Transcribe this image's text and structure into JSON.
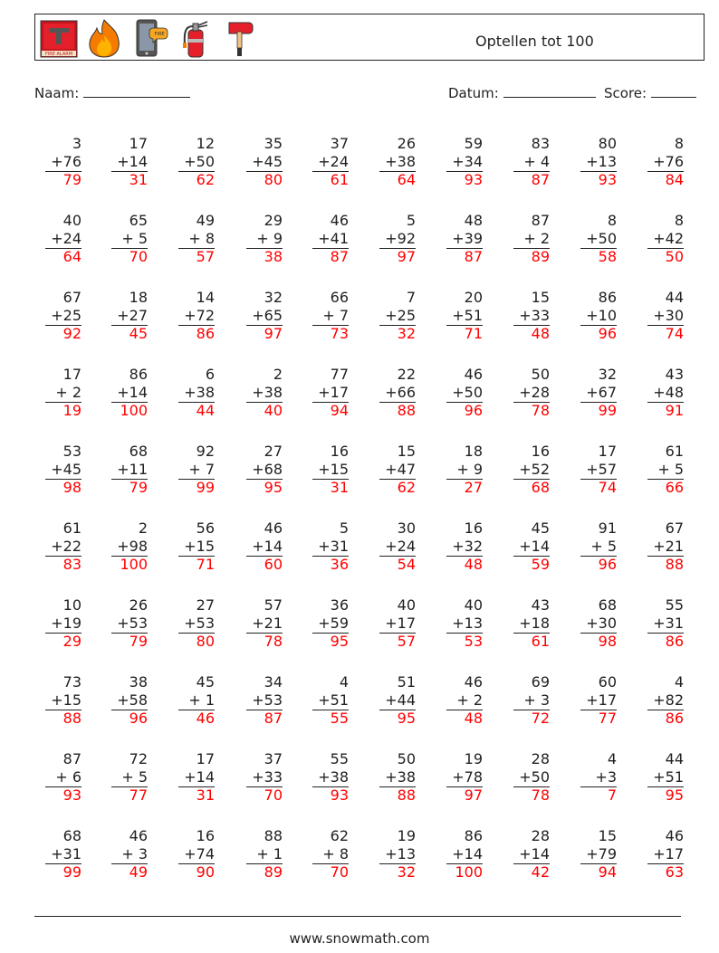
{
  "header": {
    "title": "Optellen tot 100",
    "icons": [
      "fire-alarm-icon",
      "fire-icon",
      "phone-fire-icon",
      "fire-extinguisher-icon",
      "fire-axe-icon"
    ],
    "fire_alarm_label": "FIRE ALARM",
    "phone_bubble_label": "FIRE"
  },
  "meta": {
    "name_label": "Naam:",
    "date_label": "Datum:",
    "score_label": "Score:"
  },
  "colors": {
    "answer": "#ff0000",
    "text": "#222222"
  },
  "problems": [
    [
      {
        "a": "3",
        "b": "+76",
        "ans": "79"
      },
      {
        "a": "17",
        "b": "+14",
        "ans": "31"
      },
      {
        "a": "12",
        "b": "+50",
        "ans": "62"
      },
      {
        "a": "35",
        "b": "+45",
        "ans": "80"
      },
      {
        "a": "37",
        "b": "+24",
        "ans": "61"
      },
      {
        "a": "26",
        "b": "+38",
        "ans": "64"
      },
      {
        "a": "59",
        "b": "+34",
        "ans": "93"
      },
      {
        "a": "83",
        "b": "+ 4",
        "ans": "87"
      },
      {
        "a": "80",
        "b": "+13",
        "ans": "93"
      },
      {
        "a": "8",
        "b": "+76",
        "ans": "84"
      }
    ],
    [
      {
        "a": "40",
        "b": "+24",
        "ans": "64"
      },
      {
        "a": "65",
        "b": "+ 5",
        "ans": "70"
      },
      {
        "a": "49",
        "b": "+ 8",
        "ans": "57"
      },
      {
        "a": "29",
        "b": "+ 9",
        "ans": "38"
      },
      {
        "a": "46",
        "b": "+41",
        "ans": "87"
      },
      {
        "a": "5",
        "b": "+92",
        "ans": "97"
      },
      {
        "a": "48",
        "b": "+39",
        "ans": "87"
      },
      {
        "a": "87",
        "b": "+ 2",
        "ans": "89"
      },
      {
        "a": "8",
        "b": "+50",
        "ans": "58"
      },
      {
        "a": "8",
        "b": "+42",
        "ans": "50"
      }
    ],
    [
      {
        "a": "67",
        "b": "+25",
        "ans": "92"
      },
      {
        "a": "18",
        "b": "+27",
        "ans": "45"
      },
      {
        "a": "14",
        "b": "+72",
        "ans": "86"
      },
      {
        "a": "32",
        "b": "+65",
        "ans": "97"
      },
      {
        "a": "66",
        "b": "+ 7",
        "ans": "73"
      },
      {
        "a": "7",
        "b": "+25",
        "ans": "32"
      },
      {
        "a": "20",
        "b": "+51",
        "ans": "71"
      },
      {
        "a": "15",
        "b": "+33",
        "ans": "48"
      },
      {
        "a": "86",
        "b": "+10",
        "ans": "96"
      },
      {
        "a": "44",
        "b": "+30",
        "ans": "74"
      }
    ],
    [
      {
        "a": "17",
        "b": "+ 2",
        "ans": "19"
      },
      {
        "a": "86",
        "b": "+14",
        "ans": "100"
      },
      {
        "a": "6",
        "b": "+38",
        "ans": "44"
      },
      {
        "a": "2",
        "b": "+38",
        "ans": "40"
      },
      {
        "a": "77",
        "b": "+17",
        "ans": "94"
      },
      {
        "a": "22",
        "b": "+66",
        "ans": "88"
      },
      {
        "a": "46",
        "b": "+50",
        "ans": "96"
      },
      {
        "a": "50",
        "b": "+28",
        "ans": "78"
      },
      {
        "a": "32",
        "b": "+67",
        "ans": "99"
      },
      {
        "a": "43",
        "b": "+48",
        "ans": "91"
      }
    ],
    [
      {
        "a": "53",
        "b": "+45",
        "ans": "98"
      },
      {
        "a": "68",
        "b": "+11",
        "ans": "79"
      },
      {
        "a": "92",
        "b": "+ 7",
        "ans": "99"
      },
      {
        "a": "27",
        "b": "+68",
        "ans": "95"
      },
      {
        "a": "16",
        "b": "+15",
        "ans": "31"
      },
      {
        "a": "15",
        "b": "+47",
        "ans": "62"
      },
      {
        "a": "18",
        "b": "+ 9",
        "ans": "27"
      },
      {
        "a": "16",
        "b": "+52",
        "ans": "68"
      },
      {
        "a": "17",
        "b": "+57",
        "ans": "74"
      },
      {
        "a": "61",
        "b": "+ 5",
        "ans": "66"
      }
    ],
    [
      {
        "a": "61",
        "b": "+22",
        "ans": "83"
      },
      {
        "a": "2",
        "b": "+98",
        "ans": "100"
      },
      {
        "a": "56",
        "b": "+15",
        "ans": "71"
      },
      {
        "a": "46",
        "b": "+14",
        "ans": "60"
      },
      {
        "a": "5",
        "b": "+31",
        "ans": "36"
      },
      {
        "a": "30",
        "b": "+24",
        "ans": "54"
      },
      {
        "a": "16",
        "b": "+32",
        "ans": "48"
      },
      {
        "a": "45",
        "b": "+14",
        "ans": "59"
      },
      {
        "a": "91",
        "b": "+ 5",
        "ans": "96"
      },
      {
        "a": "67",
        "b": "+21",
        "ans": "88"
      }
    ],
    [
      {
        "a": "10",
        "b": "+19",
        "ans": "29"
      },
      {
        "a": "26",
        "b": "+53",
        "ans": "79"
      },
      {
        "a": "27",
        "b": "+53",
        "ans": "80"
      },
      {
        "a": "57",
        "b": "+21",
        "ans": "78"
      },
      {
        "a": "36",
        "b": "+59",
        "ans": "95"
      },
      {
        "a": "40",
        "b": "+17",
        "ans": "57"
      },
      {
        "a": "40",
        "b": "+13",
        "ans": "53"
      },
      {
        "a": "43",
        "b": "+18",
        "ans": "61"
      },
      {
        "a": "68",
        "b": "+30",
        "ans": "98"
      },
      {
        "a": "55",
        "b": "+31",
        "ans": "86"
      }
    ],
    [
      {
        "a": "73",
        "b": "+15",
        "ans": "88"
      },
      {
        "a": "38",
        "b": "+58",
        "ans": "96"
      },
      {
        "a": "45",
        "b": "+ 1",
        "ans": "46"
      },
      {
        "a": "34",
        "b": "+53",
        "ans": "87"
      },
      {
        "a": "4",
        "b": "+51",
        "ans": "55"
      },
      {
        "a": "51",
        "b": "+44",
        "ans": "95"
      },
      {
        "a": "46",
        "b": "+ 2",
        "ans": "48"
      },
      {
        "a": "69",
        "b": "+ 3",
        "ans": "72"
      },
      {
        "a": "60",
        "b": "+17",
        "ans": "77"
      },
      {
        "a": "4",
        "b": "+82",
        "ans": "86"
      }
    ],
    [
      {
        "a": "87",
        "b": "+ 6",
        "ans": "93"
      },
      {
        "a": "72",
        "b": "+ 5",
        "ans": "77"
      },
      {
        "a": "17",
        "b": "+14",
        "ans": "31"
      },
      {
        "a": "37",
        "b": "+33",
        "ans": "70"
      },
      {
        "a": "55",
        "b": "+38",
        "ans": "93"
      },
      {
        "a": "50",
        "b": "+38",
        "ans": "88"
      },
      {
        "a": "19",
        "b": "+78",
        "ans": "97"
      },
      {
        "a": "28",
        "b": "+50",
        "ans": "78"
      },
      {
        "a": "4",
        "b": "+3",
        "ans": "7"
      },
      {
        "a": "44",
        "b": "+51",
        "ans": "95"
      }
    ],
    [
      {
        "a": "68",
        "b": "+31",
        "ans": "99"
      },
      {
        "a": "46",
        "b": "+ 3",
        "ans": "49"
      },
      {
        "a": "16",
        "b": "+74",
        "ans": "90"
      },
      {
        "a": "88",
        "b": "+ 1",
        "ans": "89"
      },
      {
        "a": "62",
        "b": "+ 8",
        "ans": "70"
      },
      {
        "a": "19",
        "b": "+13",
        "ans": "32"
      },
      {
        "a": "86",
        "b": "+14",
        "ans": "100"
      },
      {
        "a": "28",
        "b": "+14",
        "ans": "42"
      },
      {
        "a": "15",
        "b": "+79",
        "ans": "94"
      },
      {
        "a": "46",
        "b": "+17",
        "ans": "63"
      }
    ]
  ],
  "footer": {
    "url": "www.snowmath.com"
  }
}
